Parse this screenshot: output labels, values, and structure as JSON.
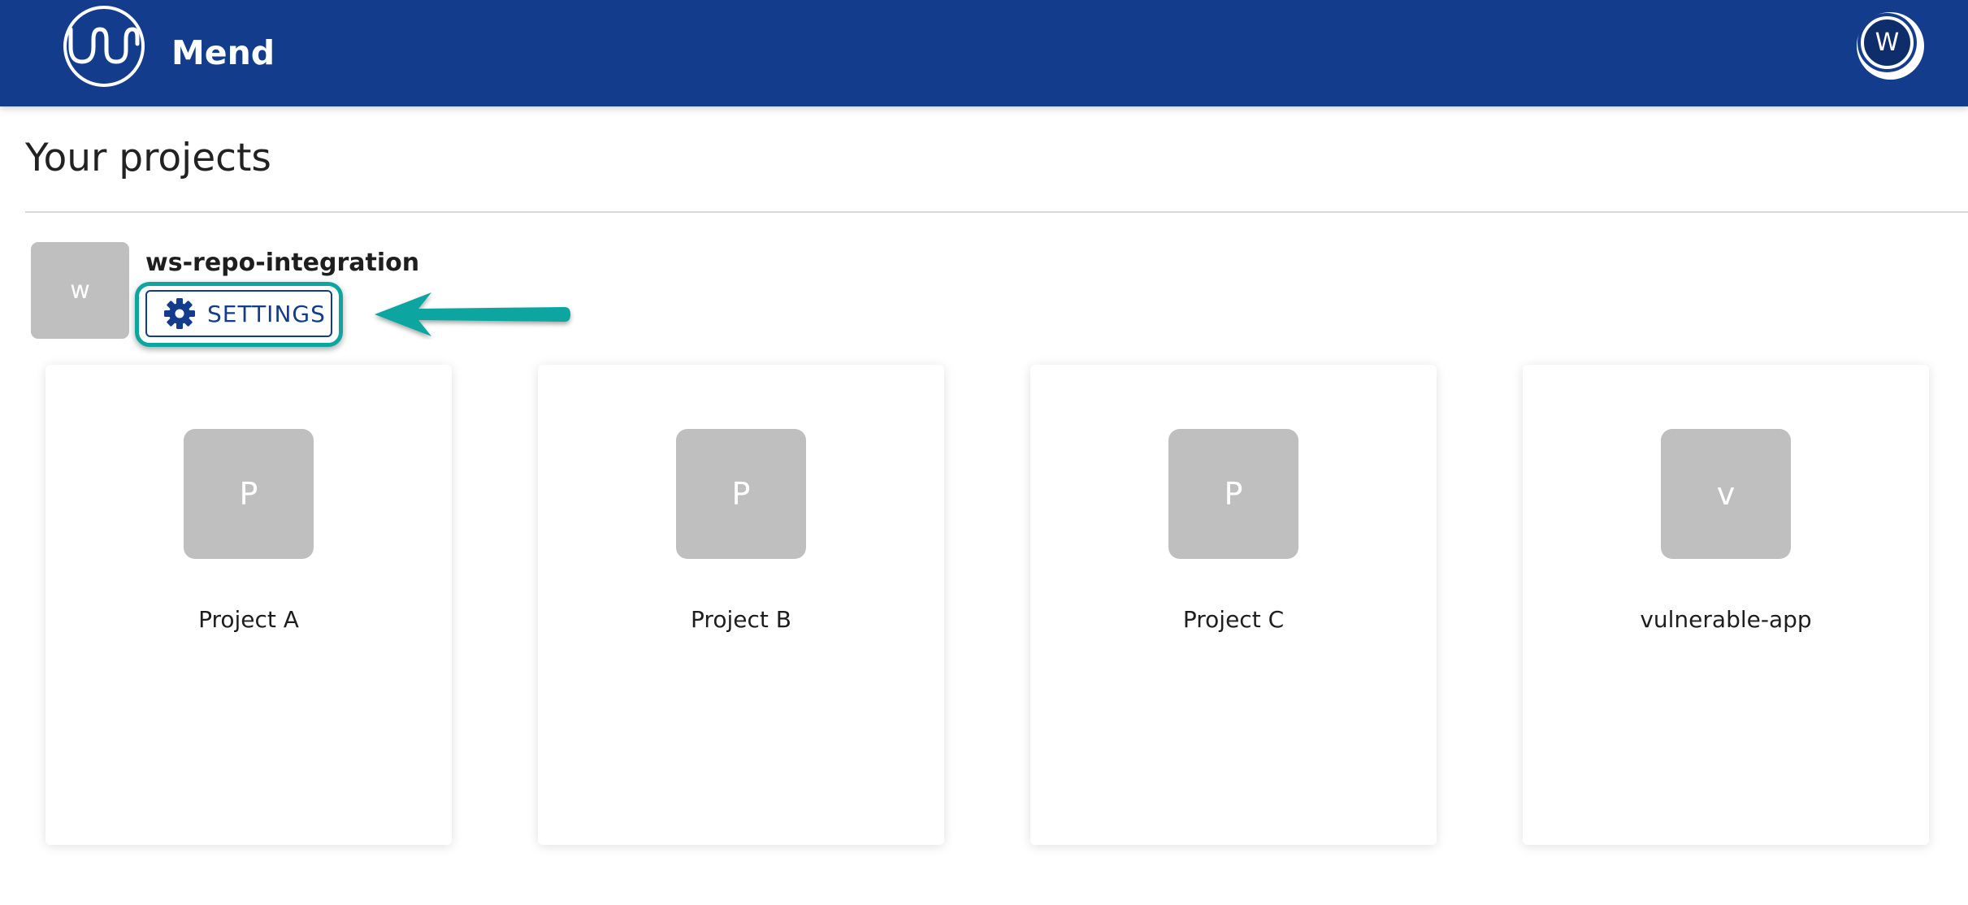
{
  "header": {
    "brand": "Mend",
    "logo_icon": "mend-wave-logo-icon",
    "user_initial": "W",
    "background_color": "#143c8c"
  },
  "page": {
    "title": "Your projects"
  },
  "organization": {
    "initial": "w",
    "name": "ws-repo-integration",
    "settings_label": "SETTINGS",
    "settings_icon": "gear-icon"
  },
  "annotation": {
    "color": "#0ea5a0"
  },
  "projects": [
    {
      "initial": "P",
      "name": "Project A"
    },
    {
      "initial": "P",
      "name": "Project B"
    },
    {
      "initial": "P",
      "name": "Project C"
    },
    {
      "initial": "v",
      "name": "vulnerable-app"
    }
  ]
}
